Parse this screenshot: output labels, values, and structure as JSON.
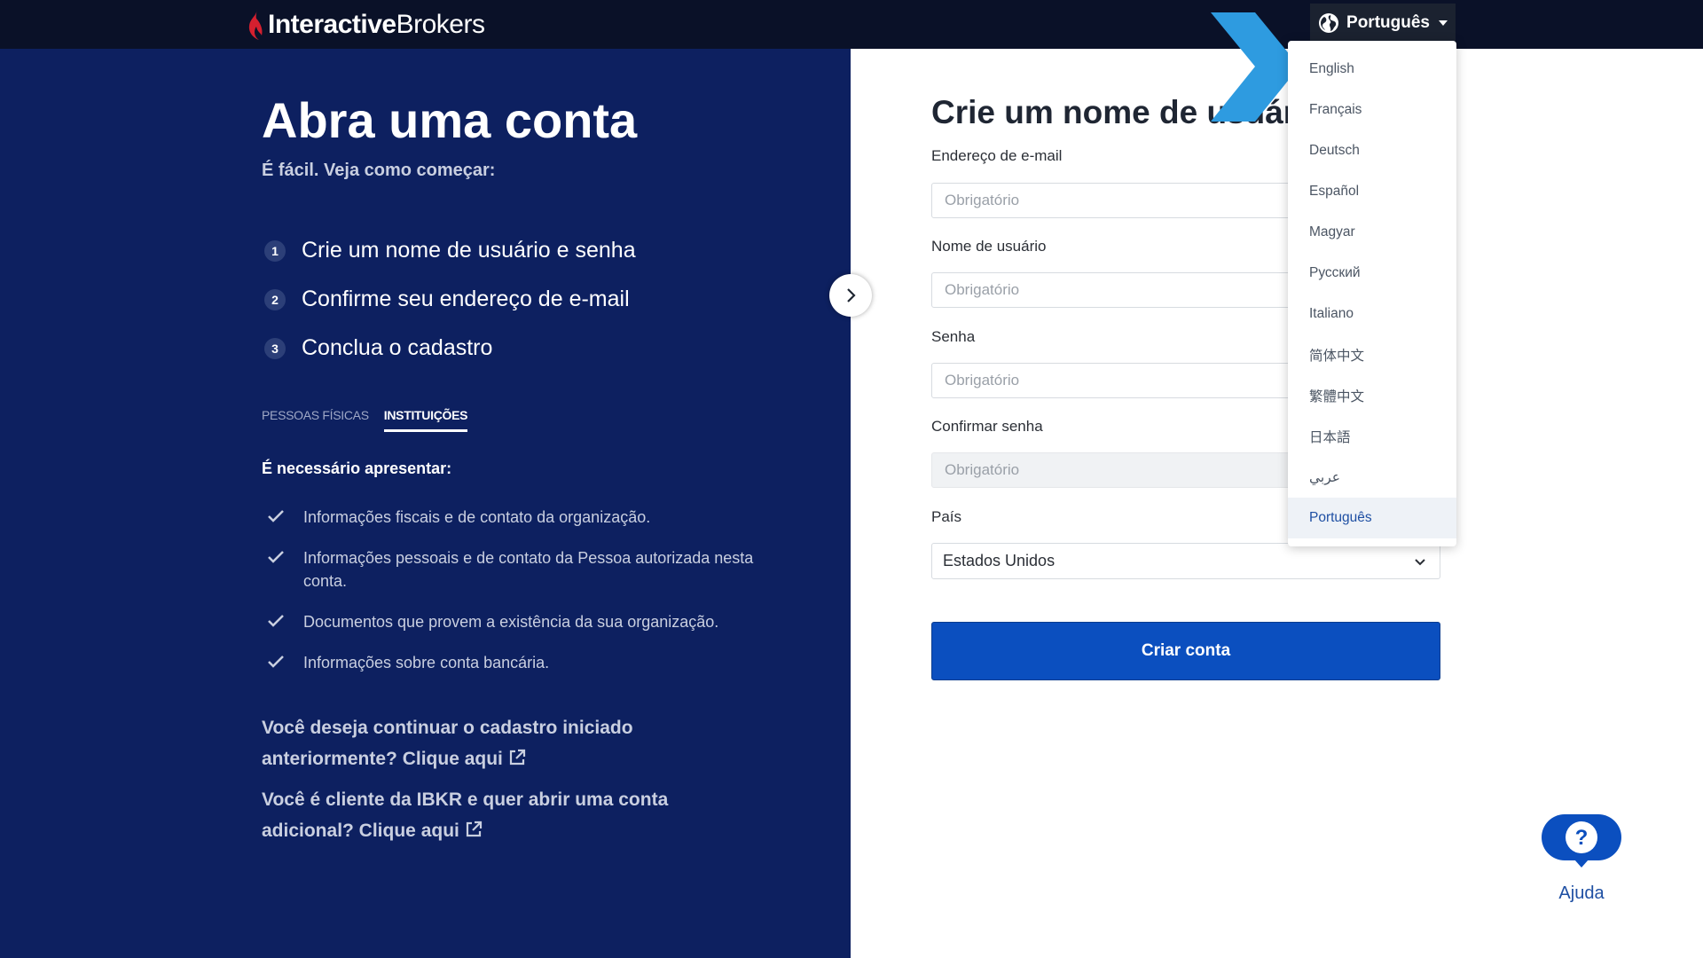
{
  "header": {
    "logo_text_bold": "Interactive",
    "logo_text_regular": "Brokers",
    "language_button_label": "Português"
  },
  "left": {
    "title": "Abra uma conta",
    "subtitle": "É fácil. Veja como começar:",
    "steps": [
      {
        "num": "1",
        "label": "Crie um nome de usuário e senha"
      },
      {
        "num": "2",
        "label": "Confirme seu endereço de e-mail"
      },
      {
        "num": "3",
        "label": "Conclua o cadastro"
      }
    ],
    "tabs": [
      {
        "label": "PESSOAS FÍSICAS"
      },
      {
        "label": "INSTITUIÇÕES"
      }
    ],
    "requirements_title": "É necessário apresentar:",
    "requirements": [
      "Informações fiscais e de contato da organização.",
      "Informações pessoais e de contato da Pessoa autorizada nesta conta.",
      "Documentos que provem a existência da sua organização.",
      "Informações sobre conta bancária."
    ],
    "continue_text": "Você deseja continuar o cadastro iniciado anteriormente? Clique aqui",
    "existing_client_text": "Você é cliente da IBKR e quer abrir uma conta adicional? Clique aqui"
  },
  "form": {
    "title": "Crie um nome de usuário",
    "email_label": "Endereço de e-mail",
    "email_placeholder": "Obrigatório",
    "username_label": "Nome de usuário",
    "username_placeholder": "Obrigatório",
    "password_label": "Senha",
    "password_placeholder": "Obrigatório",
    "confirm_label": "Confirmar senha",
    "confirm_placeholder": "Obrigatório",
    "country_label": "País",
    "country_value": "Estados Unidos",
    "submit_label": "Criar conta"
  },
  "language_menu": {
    "items": [
      "English",
      "Français",
      "Deutsch",
      "Español",
      "Magyar",
      "Русский",
      "Italiano",
      "简体中文",
      "繁體中文",
      "日本語",
      "عربي",
      "Português"
    ],
    "selected": "Português"
  },
  "help": {
    "label": "Ajuda",
    "icon_text": "?"
  },
  "colors": {
    "topbar": "#0a1128",
    "left_panel": "#0d2060",
    "primary_button": "#0b4fbf",
    "overlay_arrow": "#2e9be0",
    "flame": "#d5202f"
  }
}
